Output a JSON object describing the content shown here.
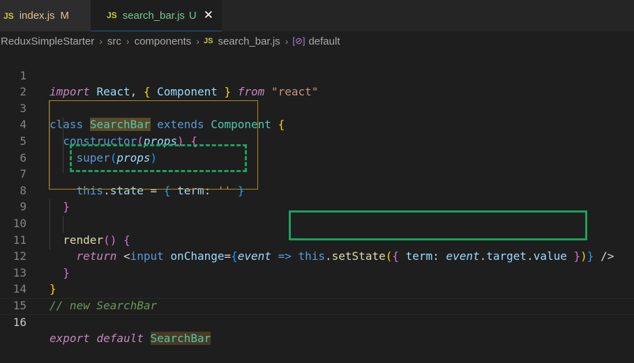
{
  "tabs": [
    {
      "badge": "JS",
      "name": "index.js",
      "status": "M"
    },
    {
      "badge": "JS",
      "name": "search_bar.js",
      "status": "U",
      "close": "✕"
    }
  ],
  "breadcrumb": {
    "items": [
      "ReduxSimpleStarter",
      "src",
      "components",
      "search_bar.js",
      "default"
    ],
    "file_badge": "JS",
    "symbol_icon": "[⊘]",
    "separator": "›"
  },
  "lines": [
    {
      "n": "1"
    },
    {
      "n": "2"
    },
    {
      "n": "3"
    },
    {
      "n": "4"
    },
    {
      "n": "5"
    },
    {
      "n": "6"
    },
    {
      "n": "7"
    },
    {
      "n": "8"
    },
    {
      "n": "9"
    },
    {
      "n": "10"
    },
    {
      "n": "11"
    },
    {
      "n": "12"
    },
    {
      "n": "13"
    },
    {
      "n": "14"
    },
    {
      "n": "15"
    },
    {
      "n": "16"
    }
  ],
  "code": {
    "import_kw": "import",
    "react_name": "React",
    "component_name": "Component",
    "from_kw": "from",
    "react_str": "\"react\"",
    "class_kw": "class",
    "searchbar": "SearchBar",
    "extends_kw": "extends",
    "constructor": "constructor",
    "props": "props",
    "super_kw": "super",
    "this_kw": "this",
    "state": "state",
    "term": "term",
    "empty_str": "''",
    "render": "render",
    "return_kw": "return",
    "input_tag": "input",
    "onchange": "onChange",
    "event": "event",
    "setstate": "setState",
    "target": "target",
    "value": "value",
    "comment": "// new SearchBar",
    "export_kw": "export",
    "default_kw": "default"
  },
  "colors": {
    "gold_box": "#b58a1e",
    "green_box": "#1aa260",
    "background": "#1e1e1e"
  }
}
